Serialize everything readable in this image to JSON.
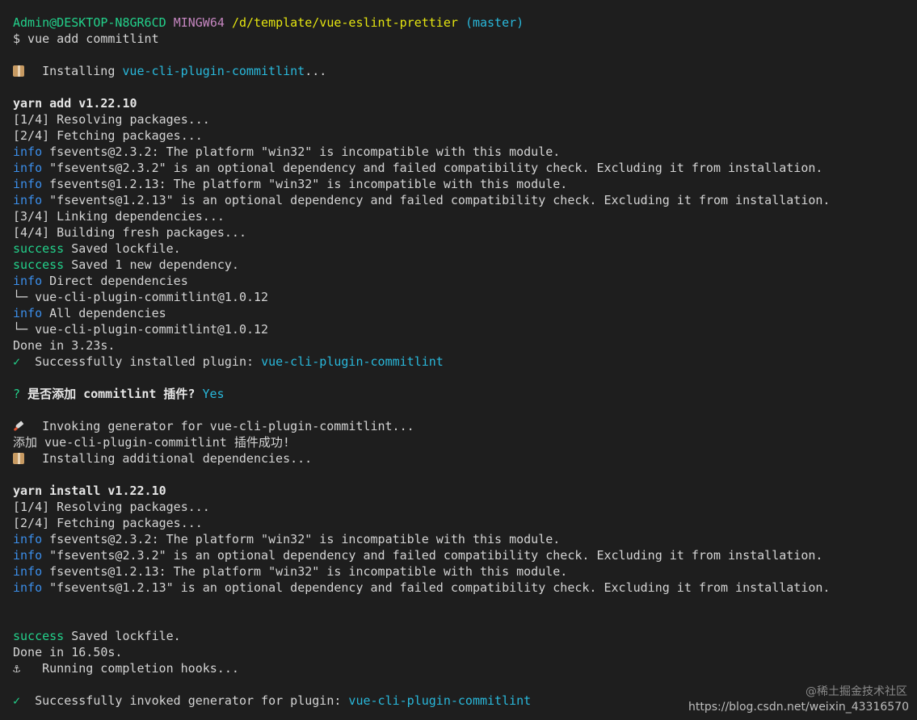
{
  "prompt": {
    "user": "Admin@DESKTOP-N8GR6CD",
    "system": "MINGW64",
    "path": "/d/template/vue-eslint-prettier",
    "branch": "(master)"
  },
  "command": "$ vue add commitlint",
  "install_plugin": {
    "prefix": "Installing ",
    "name": "vue-cli-plugin-commitlint",
    "suffix": "..."
  },
  "yarn_add": {
    "header": "yarn add v1.22.10",
    "resolving": "[1/4] Resolving packages...",
    "fetching": "[2/4] Fetching packages...",
    "info_label": "info",
    "info1": "fsevents@2.3.2: The platform \"win32\" is incompatible with this module.",
    "info2": "\"fsevents@2.3.2\" is an optional dependency and failed compatibility check. Excluding it from installation.",
    "info3": "fsevents@1.2.13: The platform \"win32\" is incompatible with this module.",
    "info4": "\"fsevents@1.2.13\" is an optional dependency and failed compatibility check. Excluding it from installation.",
    "linking": "[3/4] Linking dependencies...",
    "building": "[4/4] Building fresh packages...",
    "success_label": "success",
    "success1": "Saved lockfile.",
    "success2": "Saved 1 new dependency.",
    "direct": "Direct dependencies",
    "tree1": "└─ vue-cli-plugin-commitlint@1.0.12",
    "all": "All dependencies",
    "tree2": "└─ vue-cli-plugin-commitlint@1.0.12",
    "done": "Done in 3.23s.",
    "installed_prefix": "Successfully installed plugin: ",
    "installed_name": "vue-cli-plugin-commitlint"
  },
  "check_mark": "✓",
  "question": {
    "mark": "?",
    "text": "是否添加 commitlint 插件?",
    "answer": "Yes"
  },
  "invoke": {
    "text": "Invoking generator for vue-cli-plugin-commitlint...",
    "added": "添加 vue-cli-plugin-commitlint 插件成功!",
    "installing_additional": "Installing additional dependencies..."
  },
  "yarn_install": {
    "header": "yarn install v1.22.10",
    "resolving": "[1/4] Resolving packages...",
    "fetching": "[2/4] Fetching packages...",
    "info1": "fsevents@2.3.2: The platform \"win32\" is incompatible with this module.",
    "info2": "\"fsevents@2.3.2\" is an optional dependency and failed compatibility check. Excluding it from installation.",
    "info3": "fsevents@1.2.13: The platform \"win32\" is incompatible with this module.",
    "info4": "\"fsevents@1.2.13\" is an optional dependency and failed compatibility check. Excluding it from installation.",
    "success1": "Saved lockfile.",
    "done": "Done in 16.50s."
  },
  "hooks": {
    "anchor": "⚓",
    "text": "Running completion hooks..."
  },
  "final": {
    "prefix": "Successfully invoked generator for plugin: ",
    "name": "vue-cli-plugin-commitlint"
  },
  "watermark": {
    "site": "@稀土掘金技术社区",
    "url": "https://blog.csdn.net/weixin_43316570"
  },
  "colors": {
    "background": "#1e1e1e",
    "text": "#d4d4d4",
    "green": "#23d18b",
    "blue": "#3b8eea",
    "cyan": "#29b8db",
    "yellow": "#e5e510",
    "magenta": "#c586c0"
  }
}
